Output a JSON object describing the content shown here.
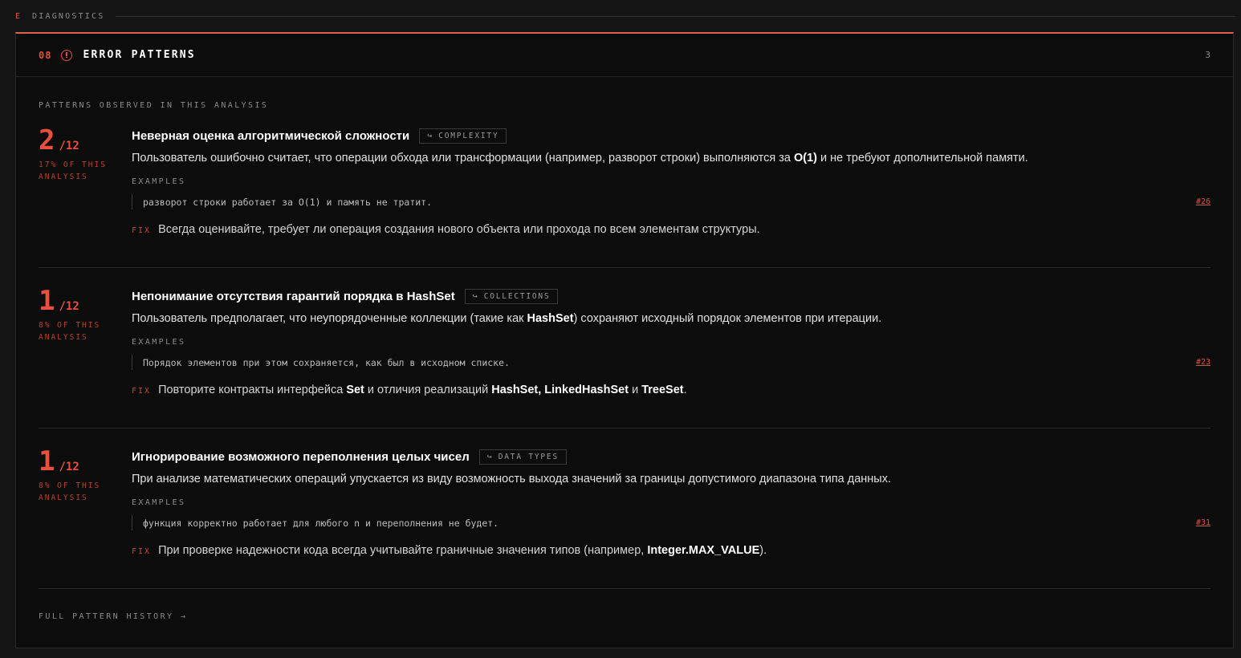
{
  "section": {
    "letter": "E",
    "title": "DIAGNOSTICS"
  },
  "card": {
    "number": "08",
    "title": "ERROR PATTERNS",
    "count": "3"
  },
  "observed_label": "PATTERNS OBSERVED IN THIS ANALYSIS",
  "examples_label": "EXAMPLES",
  "fix_label": "FIX",
  "patterns": [
    {
      "count": "2",
      "of_total": "/12",
      "percent": "17% OF THIS ANALYSIS",
      "title": "Неверная оценка алгоритмической сложности",
      "tag": "COMPLEXITY",
      "description": "Пользователь ошибочно считает, что операции обхода или трансформации (например, разворот строки) выполняются за O(1) и не требуют дополнительной памяти.",
      "example": "разворот строки работает за O(1) и память не тратит.",
      "example_ref": "#26",
      "fix_parts": [
        "Всегда оценивайте, требует ли операция создания нового объекта или прохода по всем элементам структуры."
      ]
    },
    {
      "count": "1",
      "of_total": "/12",
      "percent": "8% OF THIS ANALYSIS",
      "title": "Непонимание отсутствия гарантий порядка в HashSet",
      "tag": "COLLECTIONS",
      "description": "Пользователь предполагает, что неупорядоченные коллекции (такие как HashSet) сохраняют исходный порядок элементов при итерации.",
      "example": "Порядок элементов при этом сохраняется, как был в исходном списке.",
      "example_ref": "#23",
      "fix_parts": [
        "Повторите контракты интерфейса ",
        "Set",
        " и отличия реализаций ",
        "HashSet, LinkedHashSet",
        " и ",
        "TreeSet",
        "."
      ]
    },
    {
      "count": "1",
      "of_total": "/12",
      "percent": "8% OF THIS ANALYSIS",
      "title": "Игнорирование возможного переполнения целых чисел",
      "tag": "DATA TYPES",
      "description": "При анализе математических операций упускается из виду возможность выхода значений за границы допустимого диапазона типа данных.",
      "example": "функция корректно работает для любого n и переполнения не будет.",
      "example_ref": "#31",
      "fix_parts": [
        "При проверке надежности кода всегда учитывайте граничные значения типов (например, ",
        "Integer.MAX_VALUE",
        ")."
      ]
    }
  ],
  "full_history": "FULL PATTERN HISTORY →"
}
